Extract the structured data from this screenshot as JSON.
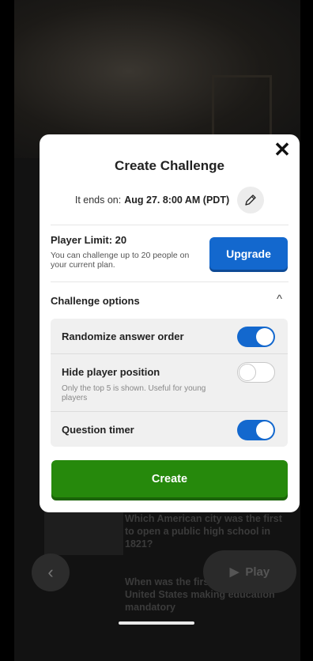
{
  "background": {
    "questions": [
      "Which American city was the first to open a public high school in 1821?",
      "When was the first law in the United States making education mandatory"
    ],
    "back_icon": "‹",
    "play_label": "Play",
    "play_icon": "▶"
  },
  "modal": {
    "close_icon": "✕",
    "title": "Create Challenge",
    "ends_prefix": "It ends on:",
    "ends_date": "Aug 27. 8:00 AM (PDT)",
    "edit_icon": "pencil-icon",
    "player_limit_title": "Player Limit: 20",
    "player_limit_desc": "You can challenge up to 20 people on your current plan.",
    "upgrade_label": "Upgrade",
    "options_title": "Challenge options",
    "collapse_icon": "^",
    "options": [
      {
        "label": "Randomize answer order",
        "enabled": true
      },
      {
        "label": "Hide player position",
        "sub": "Only the top 5 is shown. Useful for young players",
        "enabled": false
      },
      {
        "label": "Question timer",
        "enabled": true
      }
    ],
    "create_label": "Create"
  },
  "colors": {
    "primary_blue": "#1368ce",
    "create_green": "#26890c"
  }
}
